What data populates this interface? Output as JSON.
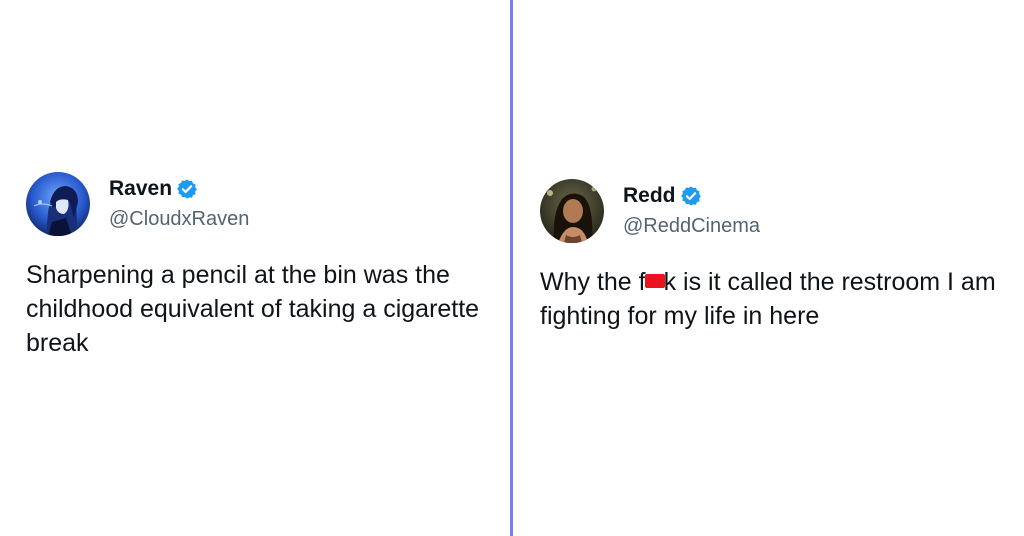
{
  "colors": {
    "divider": "#7b7ef0",
    "verified": "#1d9bf0",
    "redaction": "#e8141e"
  },
  "tweets": [
    {
      "display_name": "Raven",
      "handle": "@CloudxRaven",
      "verified": true,
      "avatar_icon": "anime-avatar",
      "body": "Sharpening a pencil at the bin was the childhood equivalent of taking a cigarette break"
    },
    {
      "display_name": "Redd",
      "handle": "@ReddCinema",
      "verified": true,
      "avatar_icon": "photo-avatar",
      "body_prefix": "Why the f",
      "body_suffix": "k is it called the restroom I am fighting for my life in here"
    }
  ]
}
